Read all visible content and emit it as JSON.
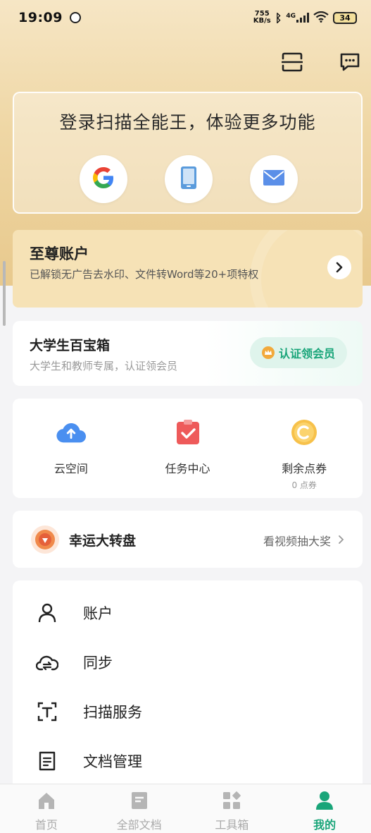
{
  "status_bar": {
    "time": "19:09",
    "net_speed_top": "755",
    "net_speed_bottom": "KB/s",
    "signal_label": "4G",
    "battery": "34"
  },
  "login": {
    "title": "登录扫描全能王，体验更多功能",
    "methods": [
      "google-icon",
      "phone-icon",
      "mail-icon"
    ]
  },
  "vip": {
    "title": "至尊账户",
    "subtitle": "已解锁无广告去水印、文件转Word等20+项特权"
  },
  "edu": {
    "title": "大学生百宝箱",
    "subtitle": "大学生和教师专属，认证领会员",
    "badge": "认证领会员"
  },
  "quick": {
    "items": [
      {
        "label": "云空间",
        "sub": ""
      },
      {
        "label": "任务中心",
        "sub": ""
      },
      {
        "label": "剩余点券",
        "sub": "0 点券"
      }
    ]
  },
  "lucky": {
    "title": "幸运大转盘",
    "action": "看视频抽大奖"
  },
  "menu": {
    "items": [
      "账户",
      "同步",
      "扫描服务",
      "文档管理"
    ]
  },
  "nav": {
    "items": [
      "首页",
      "全部文档",
      "工具箱",
      "我的"
    ],
    "active": "我的"
  },
  "colors": {
    "accent_green": "#19a579",
    "gold": "#e8c98d"
  }
}
